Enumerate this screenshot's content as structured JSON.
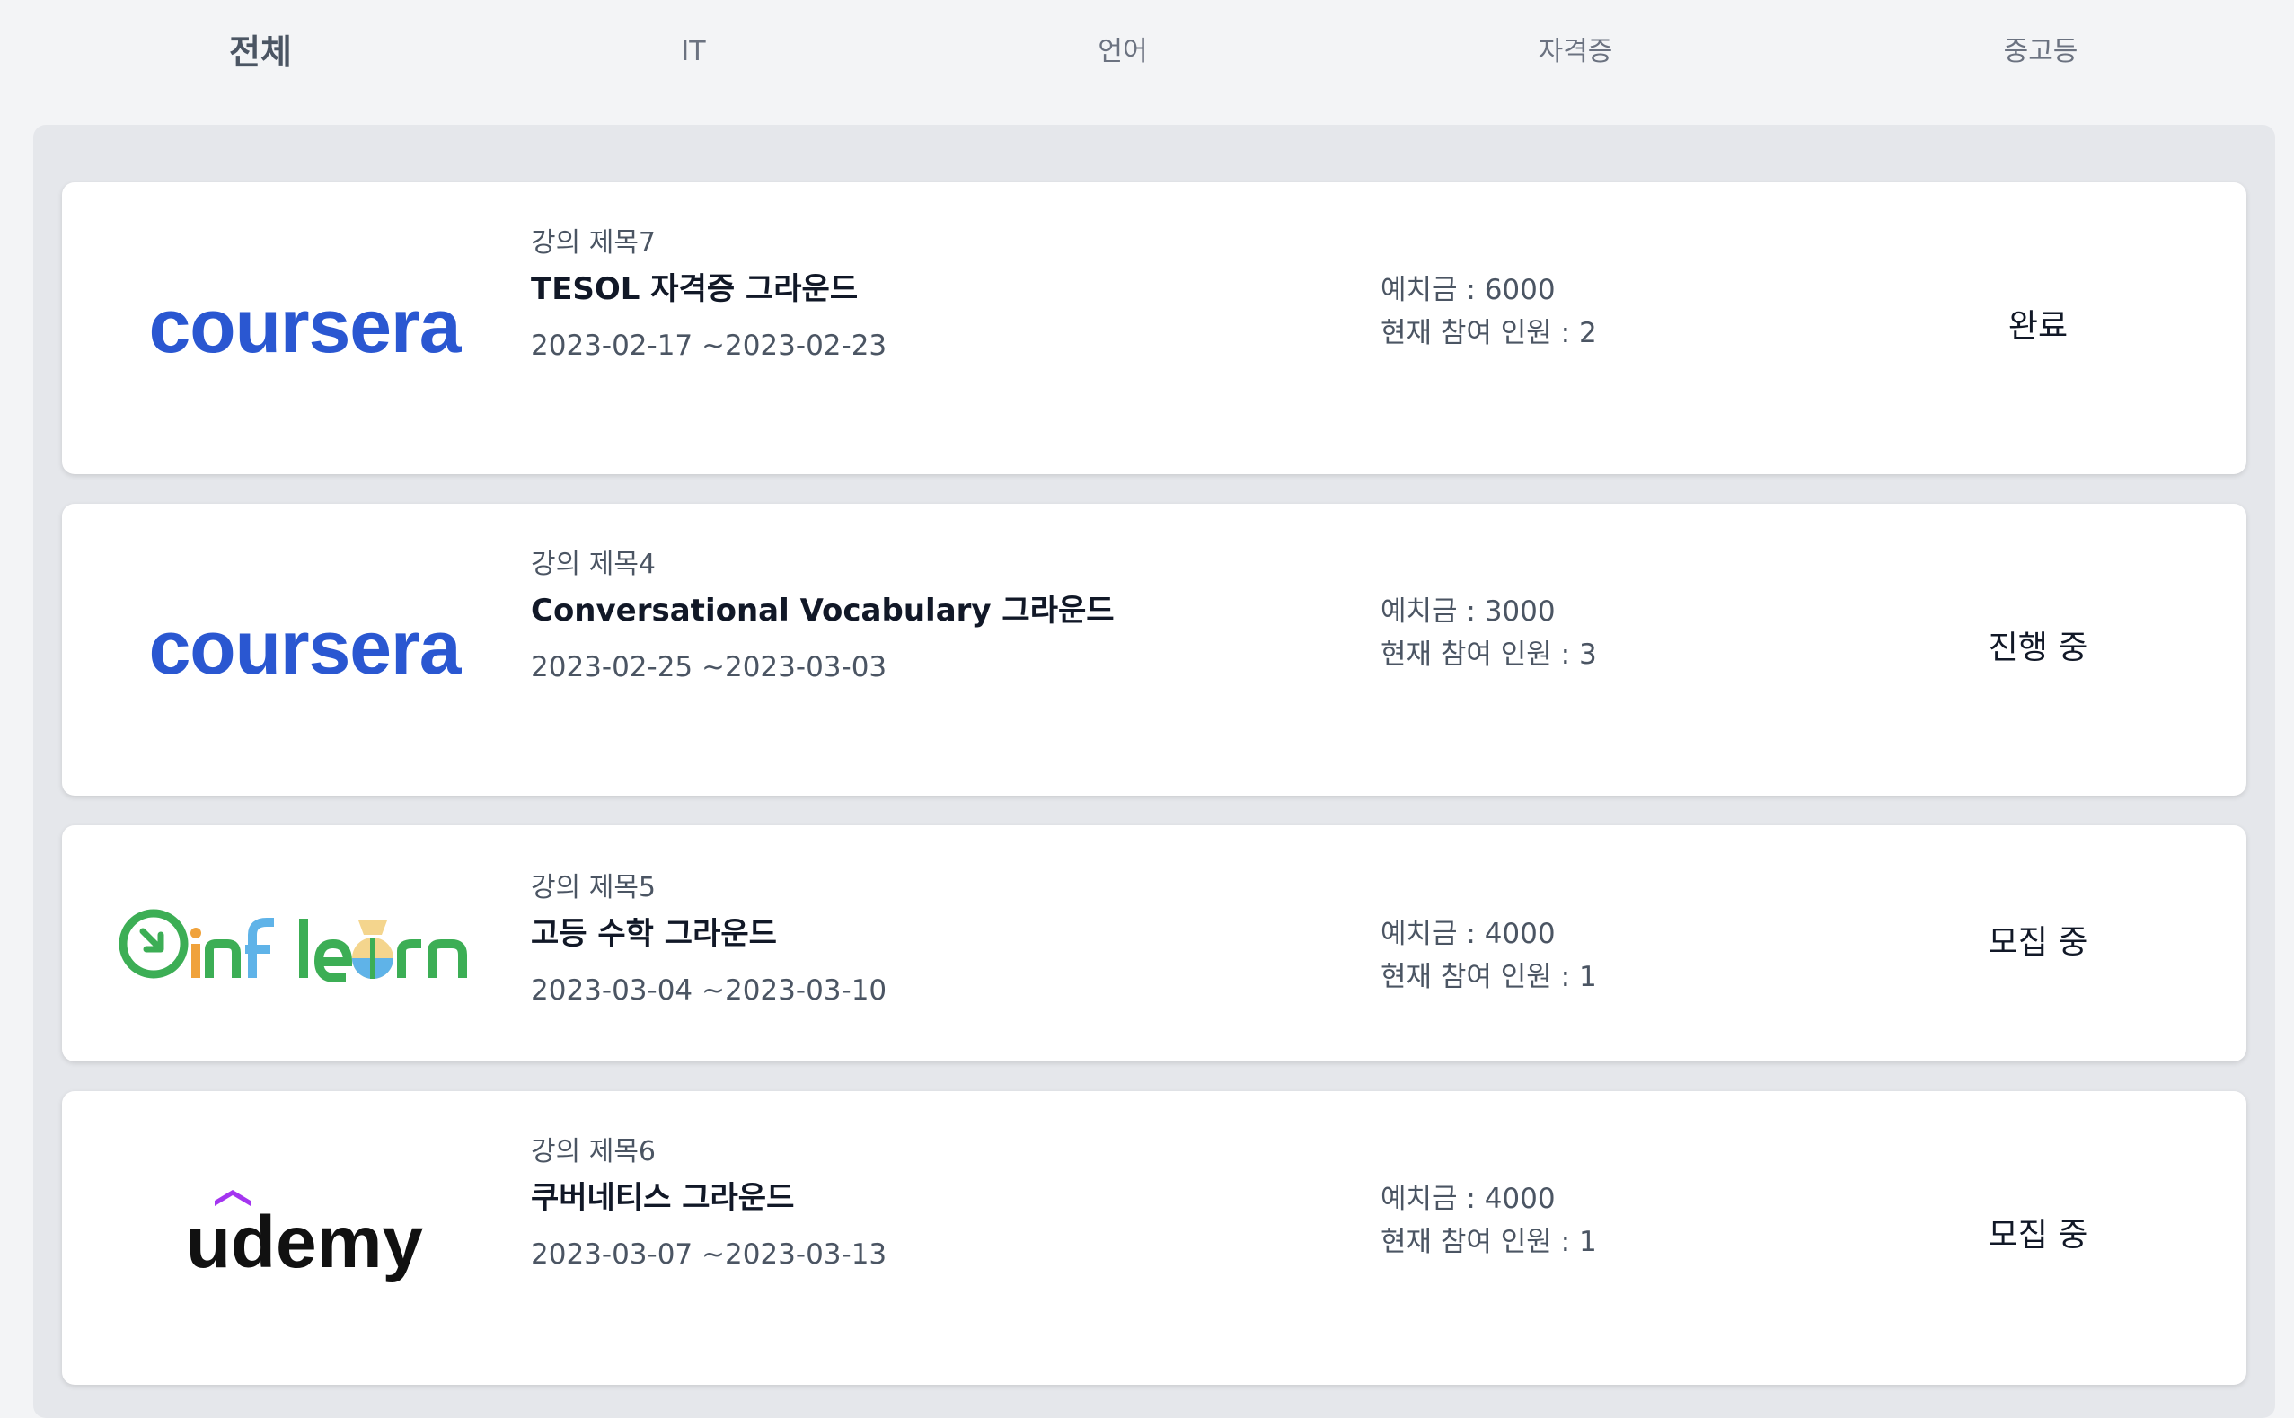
{
  "tabs": [
    {
      "label": "전체",
      "active": true
    },
    {
      "label": "IT",
      "active": false
    },
    {
      "label": "언어",
      "active": false
    },
    {
      "label": "자격증",
      "active": false
    },
    {
      "label": "중고등",
      "active": false
    }
  ],
  "courses": [
    {
      "logo": "coursera",
      "logo_icon": "coursera-logo",
      "subtitle": "강의 제목7",
      "title": "TESOL 자격증 그라운드",
      "dates": "2023-02-17 ~2023-02-23",
      "deposit": "예치금 : 6000",
      "participants": "현재 참여 인원 : 2",
      "status": "완료"
    },
    {
      "logo": "coursera",
      "logo_icon": "coursera-logo",
      "subtitle": "강의 제목4",
      "title": "Conversational Vocabulary 그라운드",
      "dates": "2023-02-25 ~2023-03-03",
      "deposit": "예치금 : 3000",
      "participants": "현재 참여 인원 : 3",
      "status": "진행 중"
    },
    {
      "logo": "inflearn",
      "logo_icon": "inflearn-logo",
      "subtitle": "강의 제목5",
      "title": "고등 수학 그라운드",
      "dates": "2023-03-04 ~2023-03-10",
      "deposit": "예치금 : 4000",
      "participants": "현재 참여 인원 : 1",
      "status": "모집 중"
    },
    {
      "logo": "udemy",
      "logo_icon": "udemy-logo",
      "subtitle": "강의 제목6",
      "title": "쿠버네티스 그라운드",
      "dates": "2023-03-07 ~2023-03-13",
      "deposit": "예치금 : 4000",
      "participants": "현재 참여 인원 : 1",
      "status": "모집 중"
    }
  ],
  "colors": {
    "background": "#f3f4f6",
    "container": "#e5e7eb",
    "card": "#ffffff",
    "coursera_blue": "#2a57d1",
    "inflearn_green": "#3cae55",
    "udemy_purple": "#a435f0"
  }
}
